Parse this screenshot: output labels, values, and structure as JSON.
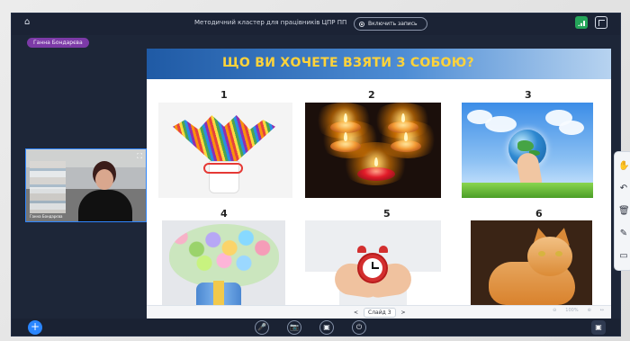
{
  "topbar": {
    "title": "Методичний кластер для працівників ЦПР ПП",
    "record_label": "Включить запись"
  },
  "participant": {
    "speaker_badge": "Ганна Бондарєва",
    "tile_name": "Ганна Бондарєва"
  },
  "slide": {
    "title": "ЩО ВИ ХОЧЕТЕ ВЗЯТИ З СОБОЮ?",
    "items": [
      {
        "number": "1",
        "image_name": "pencils-image"
      },
      {
        "number": "2",
        "image_name": "candles-image"
      },
      {
        "number": "3",
        "image_name": "globe-image"
      },
      {
        "number": "4",
        "image_name": "flowers-image"
      },
      {
        "number": "5",
        "image_name": "clock-image"
      },
      {
        "number": "6",
        "image_name": "cat-image"
      }
    ],
    "pager": {
      "prev": "<",
      "current": "Слайд 3",
      "next": ">",
      "zoom": "100%"
    }
  },
  "tools": [
    "hand-tool",
    "undo-tool",
    "trash-tool",
    "pen-tool",
    "image-tool"
  ],
  "bottom_controls": {
    "plus": "+",
    "mic": "🎤",
    "camera": "📷",
    "screen": "▣",
    "leave": "⏻"
  },
  "colors": {
    "app_bg": "#1d2638",
    "accent_blue": "#2a86ff",
    "title_yellow": "#ffd33a",
    "speaker_badge": "#7c3aa7"
  }
}
